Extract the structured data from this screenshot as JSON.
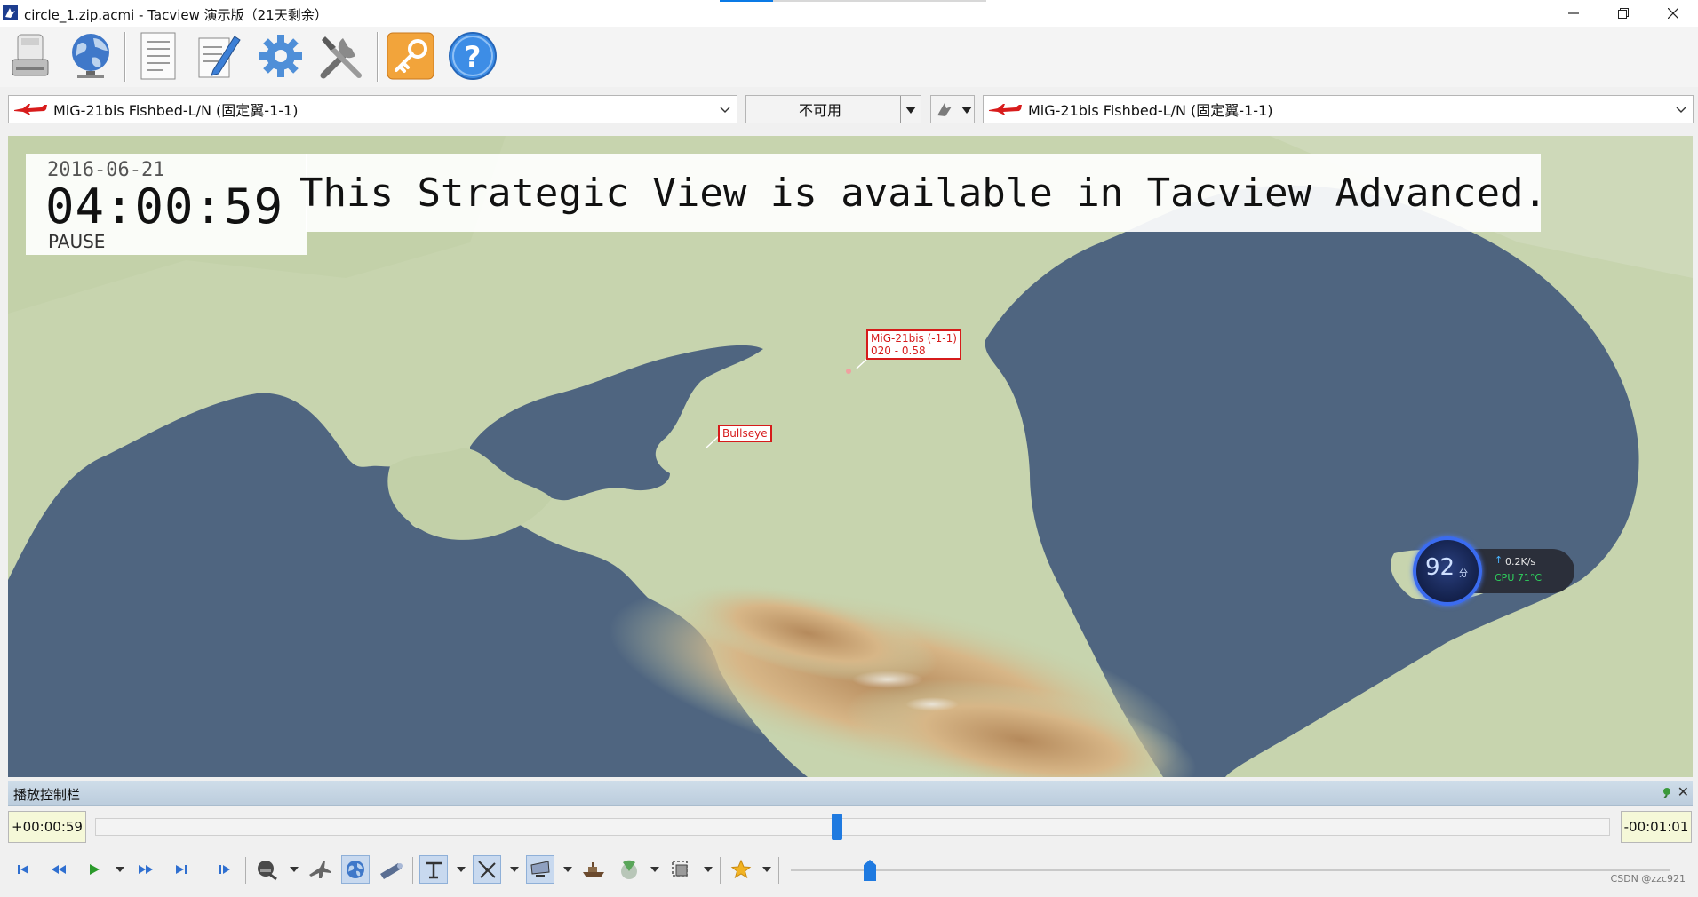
{
  "window": {
    "title": "circle_1.zip.acmi - Tacview 演示版（21天剩余）",
    "minimize_icon": "minimize-icon",
    "maximize_icon": "restore-icon",
    "close_icon": "close-icon"
  },
  "toolbar": {
    "items": [
      {
        "name": "save-drive-icon"
      },
      {
        "name": "globe-network-icon"
      },
      {
        "name": "document-icon"
      },
      {
        "name": "edit-notes-icon"
      },
      {
        "name": "settings-gear-icon"
      },
      {
        "name": "tools-icon"
      },
      {
        "name": "license-key-icon"
      },
      {
        "name": "help-icon"
      }
    ]
  },
  "selectors": {
    "primary_object": "MiG-21bis Fishbed-L/N (固定翼-1-1)",
    "relation": "不可用",
    "secondary_object": "MiG-21bis Fishbed-L/N (固定翼-1-1)"
  },
  "map": {
    "date": "2016-06-21",
    "time": "04:00:59",
    "state": "PAUSE",
    "banner": "This Strategic View is available in Tacview Advanced.",
    "aircraft_label_line1": "MiG-21bis (-1-1)",
    "aircraft_label_line2": "020 - 0.58",
    "bullseye_label": "Bullseye"
  },
  "system_widget": {
    "score": "92",
    "score_unit": "分",
    "net_speed": "0.2K/s",
    "cpu": "CPU 71°C"
  },
  "playback": {
    "panel_title": "播放控制栏",
    "elapsed": "+00:00:59",
    "remaining": "-00:01:01",
    "timeline_progress": 0.49,
    "speed_level": 0.09
  },
  "watermark": "CSDN @zzc921",
  "colors": {
    "accent": "#1f7ae0",
    "tag_red": "#d61b1b",
    "sea": "#4f6580",
    "land": "#c5d3ad"
  }
}
